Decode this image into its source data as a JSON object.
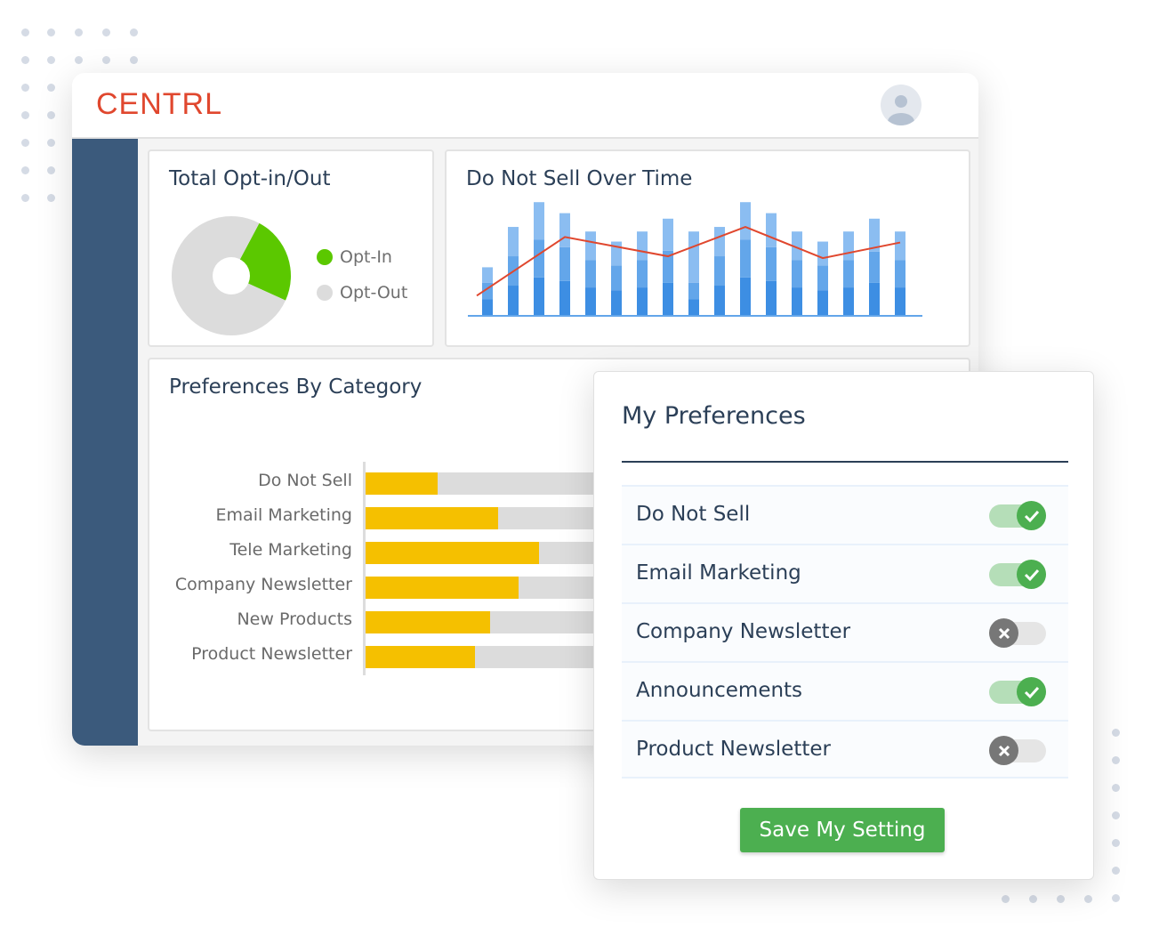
{
  "header": {
    "logo": "CENTRL",
    "avatar_icon": "user-avatar-icon"
  },
  "colors": {
    "brand": "#e0472e",
    "sidebar": "#3b5a7c",
    "opt_in": "#5bc800",
    "opt_out": "#dcdcdc",
    "bar_fill": "#f5c000",
    "bar_track": "#dcdcdc",
    "line": "#e0472e",
    "toggle_on": "#4caf50",
    "toggle_off": "#777777",
    "save": "#4caf50"
  },
  "chart_data": [
    {
      "type": "pie",
      "title": "Total Opt-in/Out",
      "donut": true,
      "slices": [
        {
          "name": "Opt-In",
          "value": 24,
          "color": "#5bc800"
        },
        {
          "name": "Opt-Out",
          "value": 76,
          "color": "#dcdcdc"
        }
      ]
    },
    {
      "type": "bar",
      "title": "Do Not Sell Over Time",
      "stacked": true,
      "grid": false,
      "series": [
        {
          "values": [
            17,
            32,
            41,
            37,
            30,
            27,
            30,
            35,
            17,
            32,
            41,
            37,
            30,
            27,
            30,
            35,
            30
          ],
          "color": "#3d8ee3"
        },
        {
          "values": [
            18,
            32,
            41,
            37,
            30,
            27,
            30,
            35,
            18,
            32,
            41,
            37,
            30,
            27,
            30,
            34,
            30
          ],
          "color": "#63a6ea"
        },
        {
          "values": [
            17,
            32,
            41,
            37,
            31,
            26,
            31,
            35,
            56,
            32,
            41,
            37,
            31,
            26,
            31,
            36,
            31
          ],
          "color": "#8bbdf1"
        }
      ],
      "line": {
        "points": [
          [
            0,
            21
          ],
          [
            3,
            85
          ],
          [
            7,
            64
          ],
          [
            10,
            96
          ],
          [
            13,
            62
          ],
          [
            16,
            79
          ]
        ],
        "color": "#e0472e"
      },
      "ylim": [
        0,
        130
      ]
    },
    {
      "type": "bar",
      "orientation": "horizontal",
      "title": "Preferences By Category",
      "categories": [
        "Do Not Sell",
        "Email Marketing",
        "Tele Marketing",
        "Company Newsletter",
        "New Products",
        "Product Newsletter"
      ],
      "values": [
        12.5,
        23,
        30,
        26.5,
        21.5,
        19
      ],
      "xlim": [
        0,
        100
      ]
    }
  ],
  "preferences": {
    "title": "My Preferences",
    "items": [
      {
        "label": "Do Not Sell",
        "on": true
      },
      {
        "label": "Email Marketing",
        "on": true
      },
      {
        "label": "Company Newsletter",
        "on": false
      },
      {
        "label": "Announcements",
        "on": true
      },
      {
        "label": "Product Newsletter",
        "on": false
      }
    ],
    "save_label": "Save My Setting"
  }
}
